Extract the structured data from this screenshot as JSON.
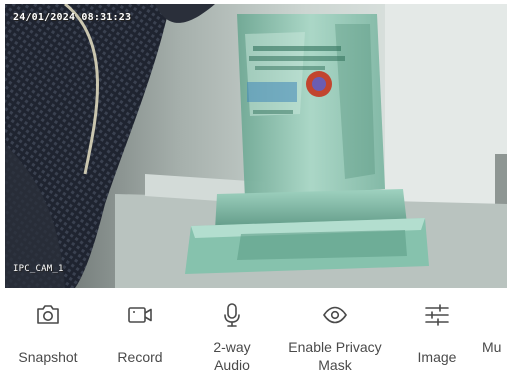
{
  "feed": {
    "timestamp": "24/01/2024 08:31:23",
    "device_name": "IPC_CAM_1"
  },
  "controls": [
    {
      "label_line1": "Snapshot",
      "label_line2": "",
      "icon": "camera-icon"
    },
    {
      "label_line1": "Record",
      "label_line2": "",
      "icon": "video-camera-icon"
    },
    {
      "label_line1": "2-way",
      "label_line2": "Audio",
      "icon": "microphone-icon"
    },
    {
      "label_line1": "Enable Privacy",
      "label_line2": "Mask",
      "icon": "eye-icon"
    },
    {
      "label_line1": "Image",
      "label_line2": "",
      "icon": "sliders-icon"
    },
    {
      "label_line1": "Mu",
      "label_line2": "",
      "icon": ""
    }
  ],
  "colors": {
    "label_text": "#4a4a4a",
    "icon_stroke": "#4a4a4a",
    "overlay_text": "#ffffff"
  }
}
